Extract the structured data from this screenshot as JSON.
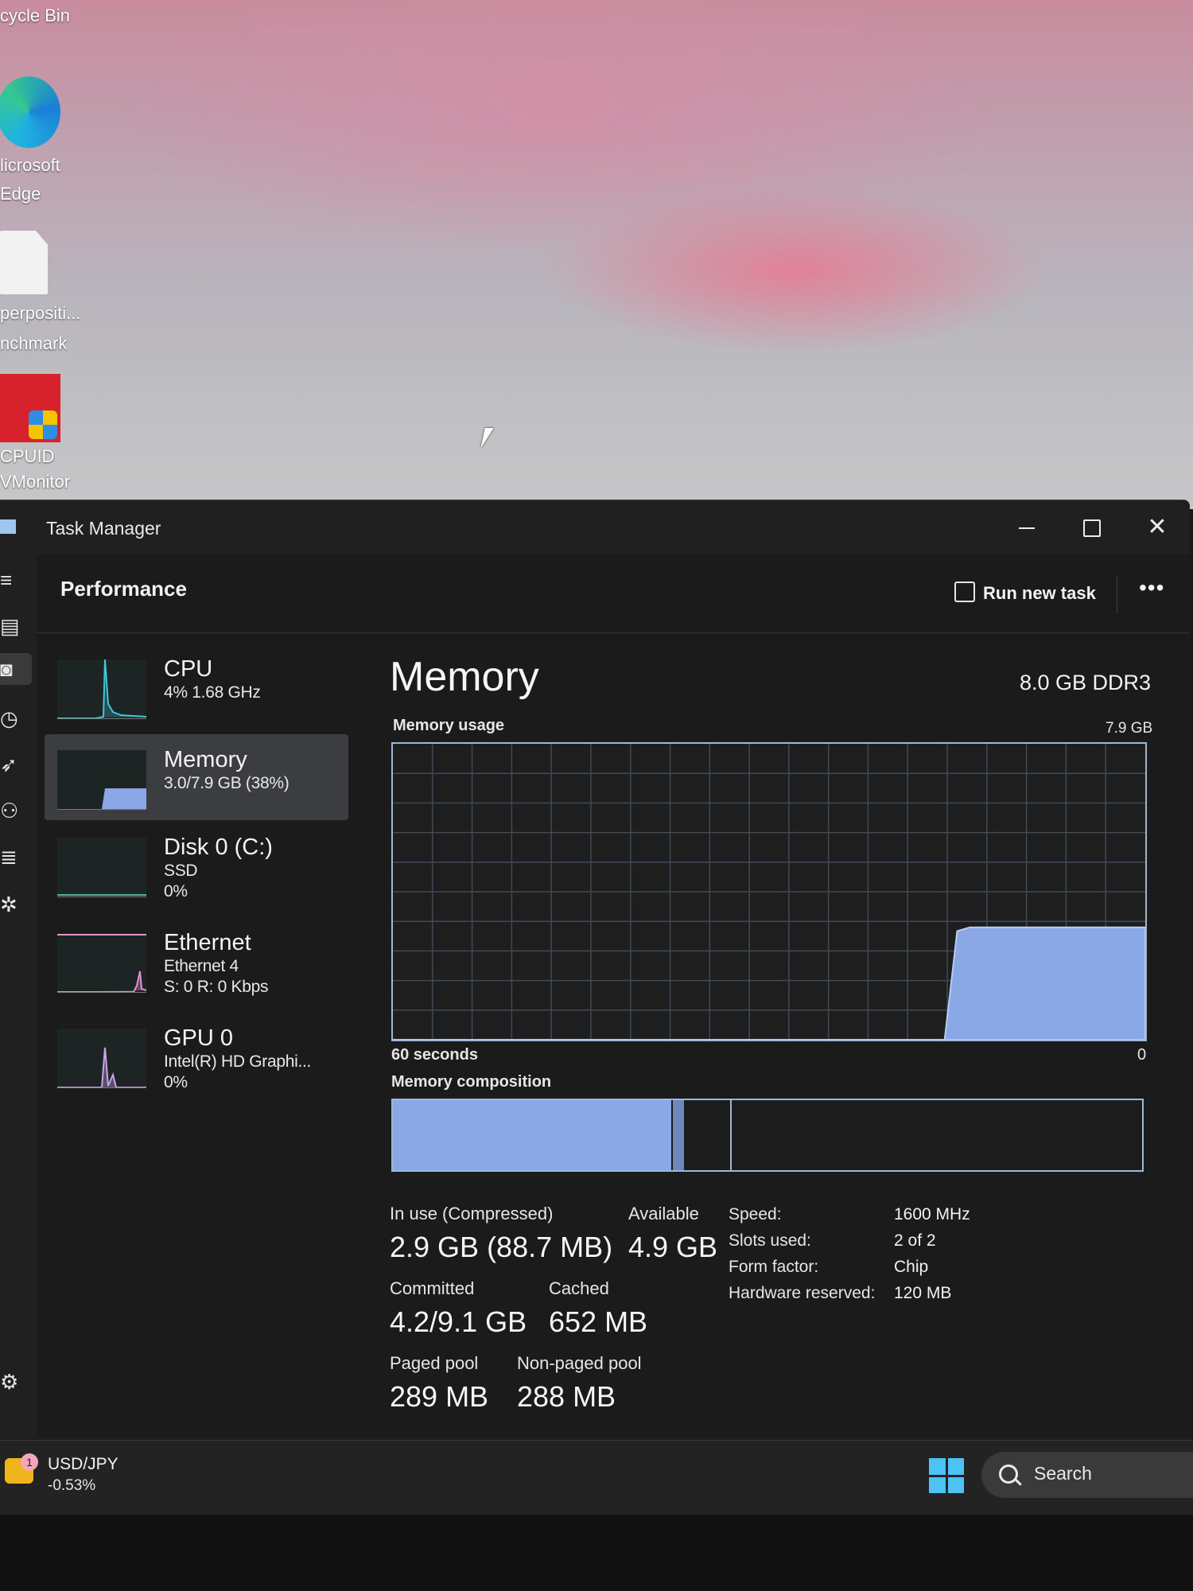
{
  "desktop": {
    "icons": [
      {
        "label": "cycle Bin"
      },
      {
        "label_lines": [
          "licrosoft",
          "Edge"
        ]
      },
      {
        "label_lines": [
          "perpositi...",
          "nchmark"
        ]
      },
      {
        "label_lines": [
          "CPUID",
          "VMonitor"
        ]
      }
    ]
  },
  "window": {
    "title": "Task Manager",
    "controls": {
      "close": "✕"
    }
  },
  "nav": {
    "icons": [
      "hamburger-icon",
      "processes-icon",
      "performance-icon",
      "history-icon",
      "startup-icon",
      "users-icon",
      "details-icon",
      "services-icon",
      "settings-icon"
    ]
  },
  "toolbar": {
    "page_title": "Performance",
    "run_new_task": "Run new task",
    "more": "•••"
  },
  "perf_list": [
    {
      "name": "CPU",
      "sub1": "4%  1.68 GHz",
      "sub2": "",
      "color": "#3fc7d6"
    },
    {
      "name": "Memory",
      "sub1": "3.0/7.9 GB (38%)",
      "sub2": "",
      "color": "#8aa7e6",
      "selected": true
    },
    {
      "name": "Disk 0 (C:)",
      "sub1": "SSD",
      "sub2": "0%",
      "color": "#4fb3a0"
    },
    {
      "name": "Ethernet",
      "sub1": "Ethernet 4",
      "sub2": "S: 0  R: 0 Kbps",
      "color": "#e08fd0"
    },
    {
      "name": "GPU 0",
      "sub1": "Intel(R) HD Graphi...",
      "sub2": "0%",
      "color": "#c9a2e8"
    }
  ],
  "detail": {
    "title": "Memory",
    "total": "8.0 GB DDR3",
    "usage_label": "Memory usage",
    "usage_max": "7.9 GB",
    "axis_left": "60 seconds",
    "axis_right": "0",
    "composition_label": "Memory composition",
    "stats": {
      "in_use_label": "In use (Compressed)",
      "in_use_value": "2.9 GB (88.7 MB)",
      "available_label": "Available",
      "available_value": "4.9 GB",
      "committed_label": "Committed",
      "committed_value": "4.2/9.1 GB",
      "cached_label": "Cached",
      "cached_value": "652 MB",
      "paged_label": "Paged pool",
      "paged_value": "289 MB",
      "nonpaged_label": "Non-paged pool",
      "nonpaged_value": "288 MB"
    },
    "properties": [
      {
        "label": "Speed:",
        "value": "1600 MHz"
      },
      {
        "label": "Slots used:",
        "value": "2 of 2"
      },
      {
        "label": "Form factor:",
        "value": "Chip"
      },
      {
        "label": "Hardware reserved:",
        "value": "120 MB"
      }
    ],
    "chart_data": {
      "type": "area",
      "ylabel": "Memory usage",
      "ylim": [
        0,
        7.9
      ],
      "xlim": [
        60,
        0
      ],
      "x": [
        60,
        16,
        15,
        14,
        10,
        5,
        0
      ],
      "values": [
        0,
        0,
        2.9,
        3.0,
        3.0,
        3.0,
        3.0
      ],
      "grid": true,
      "color": "#8aa7e6"
    },
    "composition": {
      "in_use_gb": 2.9,
      "modified_gb": 0.1,
      "standby_gb": 0.5,
      "free_gb": 4.4,
      "total_gb": 7.9
    }
  },
  "taskbar": {
    "ticker_name": "USD/JPY",
    "ticker_change": "-0.53%",
    "badge": "1",
    "search": "Search"
  }
}
